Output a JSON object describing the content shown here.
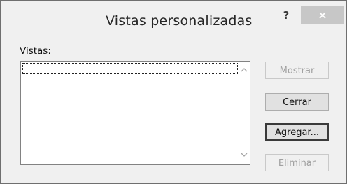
{
  "dialog": {
    "title": "Vistas personalizadas",
    "help_label": "?",
    "close_icon": "close-icon"
  },
  "list": {
    "label_accel": "V",
    "label_rest": "istas:",
    "items": [
      ""
    ]
  },
  "buttons": {
    "show": {
      "label": "Mostrar",
      "enabled": false
    },
    "close": {
      "accel": "C",
      "rest": "errar",
      "enabled": true
    },
    "add": {
      "accel": "A",
      "rest": "gregar...",
      "enabled": true
    },
    "delete": {
      "label": "Eliminar",
      "enabled": false
    }
  },
  "colors": {
    "dialog_bg": "#f0f0f0",
    "close_bg": "#c7c7c7",
    "disabled_text": "#a0a0a0"
  }
}
